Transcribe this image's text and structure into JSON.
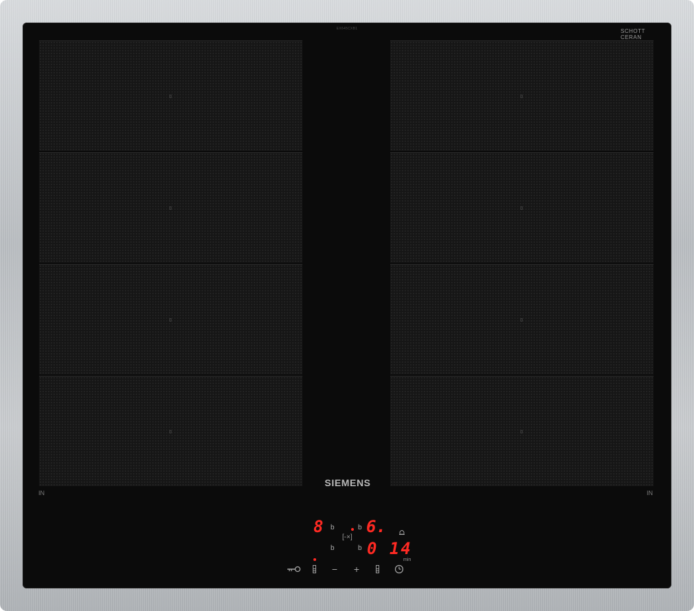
{
  "hob": {
    "model_code": "EX645CXB1",
    "brand": "SIEMENS",
    "glass_badge_line1": "SCHOTT",
    "glass_badge_line2": "CERAN",
    "zone_label_left": "IN",
    "zone_label_right": "IN"
  },
  "display": {
    "left_power_level": "8",
    "left_indicator": "b",
    "left_lower_indicator": "b",
    "right_power_level": "6.",
    "right_indicator": "b",
    "right_lower_indicator": "b",
    "flex_link_icon": "flex-zone-link-icon",
    "timer_value": "0 14",
    "timer_unit": "min",
    "alarm_icon": "bell-icon"
  },
  "controls": {
    "lock": "key-lock-icon",
    "left_zone_select": "zone-select-left-icon",
    "minus": "−",
    "plus": "+",
    "right_zone_select": "zone-select-right-icon",
    "timer": "clock-icon"
  },
  "colors": {
    "frame": "#c0c3c6",
    "glass": "#0b0b0b",
    "led": "#ff2a23"
  }
}
